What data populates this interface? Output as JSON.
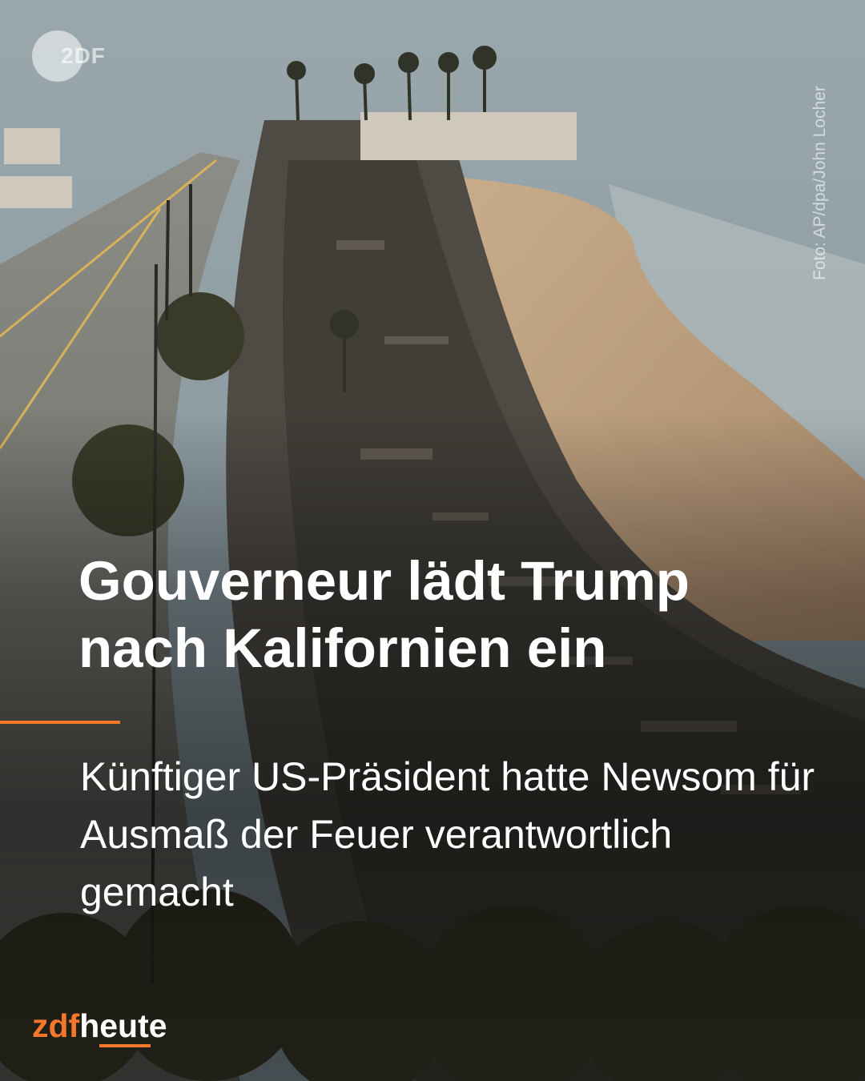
{
  "post": {
    "headline": "Gouverneur lädt Trump nach Kalifornien ein",
    "subline": "Künftiger US-Präsident hatte Newsom für Ausmaß der Feuer verantwortlich gemacht",
    "photo_credit": "Foto: AP/dpa/John Locher"
  },
  "logos": {
    "top_logo_text": "2DF",
    "brand_zdf": "zdf",
    "brand_heute": "heute"
  },
  "colors": {
    "accent": "#f5782a",
    "text": "#ffffff"
  },
  "image": {
    "description_icon": "aerial-photo-burned-beach-houses"
  }
}
